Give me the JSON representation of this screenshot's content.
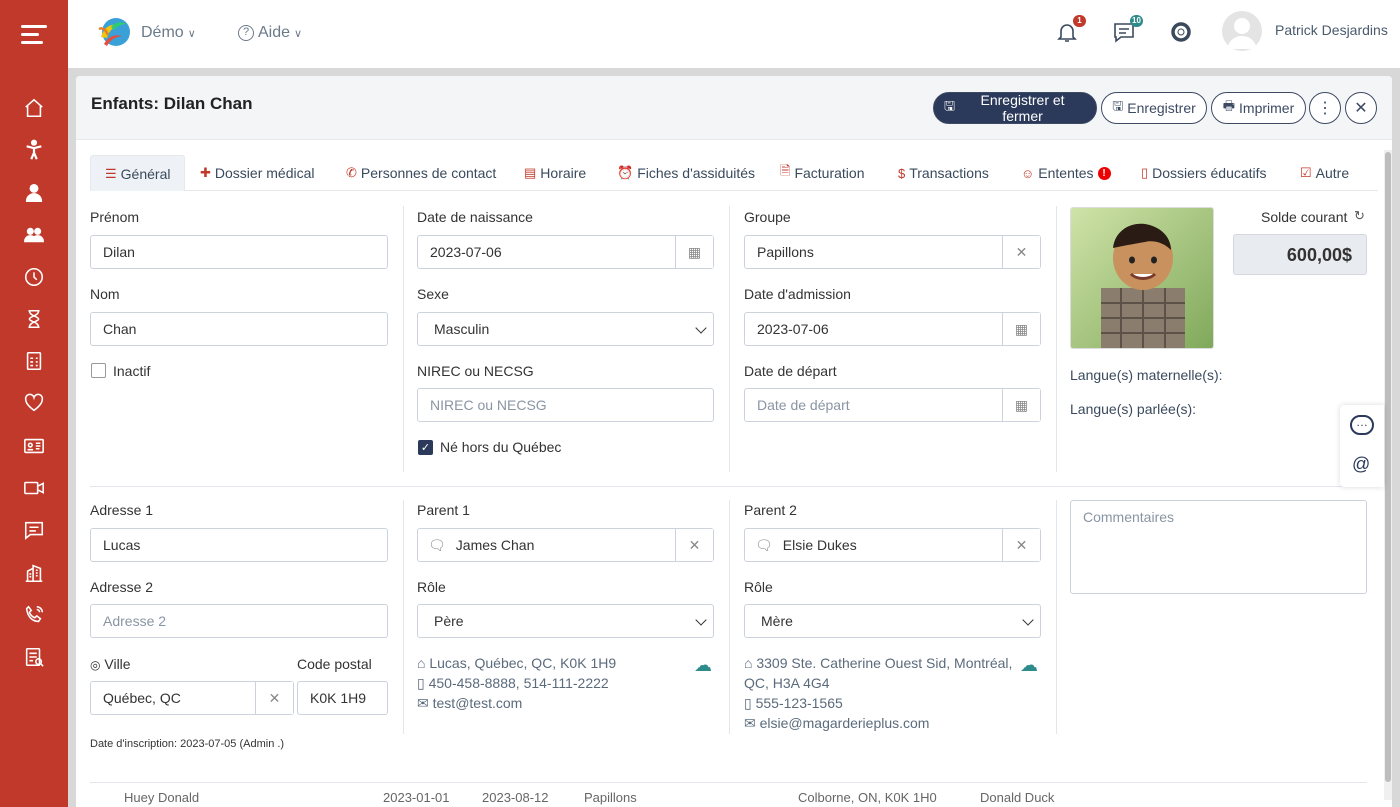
{
  "topbar": {
    "demo_label": "Démo",
    "help_label": "Aide",
    "bell_badge": "1",
    "chat_badge": "10",
    "username": "Patrick Desjardins"
  },
  "sidebar": {
    "icons": [
      "home-icon",
      "child-icon",
      "person-icon",
      "group-icon",
      "clock-icon",
      "hourglass-icon",
      "report-icon",
      "heart-icon",
      "id-card-icon",
      "video-icon",
      "message-icon",
      "building-icon",
      "phone-icon",
      "checklist-icon"
    ]
  },
  "modal": {
    "title": "Enfants: Dilan Chan",
    "buttons": {
      "save_close": "Enregistrer et fermer",
      "save": "Enregistrer",
      "print": "Imprimer"
    }
  },
  "tabs": [
    {
      "label": "Général"
    },
    {
      "label": "Dossier médical"
    },
    {
      "label": "Personnes de contact"
    },
    {
      "label": "Horaire"
    },
    {
      "label": "Fiches d'assiduités"
    },
    {
      "label": "Facturation"
    },
    {
      "label": "Transactions"
    },
    {
      "label": "Ententes"
    },
    {
      "label": "Dossiers éducatifs"
    },
    {
      "label": "Autre"
    }
  ],
  "form": {
    "prenom_label": "Prénom",
    "prenom_value": "Dilan",
    "nom_label": "Nom",
    "nom_value": "Chan",
    "inactif_label": "Inactif",
    "dob_label": "Date de naissance",
    "dob_value": "2023-07-06",
    "sexe_label": "Sexe",
    "sexe_value": "Masculin",
    "nirec_label": "NIREC ou NECSG",
    "nirec_placeholder": "NIREC ou NECSG",
    "ne_hors_label": "Né hors du Québec",
    "groupe_label": "Groupe",
    "groupe_value": "Papillons",
    "admission_label": "Date d'admission",
    "admission_value": "2023-07-06",
    "depart_label": "Date de départ",
    "depart_placeholder": "Date de départ",
    "solde_label": "Solde courant",
    "solde_value": "600,00$",
    "langue_mat_label": "Langue(s) maternelle(s):",
    "langue_parl_label": "Langue(s) parlée(s):",
    "adresse1_label": "Adresse 1",
    "adresse1_value": "Lucas",
    "adresse2_label": "Adresse 2",
    "adresse2_placeholder": "Adresse 2",
    "ville_label": "Ville",
    "ville_value": "Québec, QC",
    "postal_label": "Code postal",
    "postal_value": "K0K 1H9",
    "inscription": "Date d'inscription: 2023-07-05 (Admin .)",
    "commentaires_placeholder": "Commentaires"
  },
  "parent1": {
    "label": "Parent 1",
    "name": "James Chan",
    "role_label": "Rôle",
    "role_value": "Père",
    "address": "Lucas, Québec, QC, K0K 1H9",
    "phone": "450-458-8888, 514-111-2222",
    "email": "test@test.com"
  },
  "parent2": {
    "label": "Parent 2",
    "name": "Elsie Dukes",
    "role_label": "Rôle",
    "role_value": "Mère",
    "address_line1": "3309 Ste. Catherine Ouest Sid, Montréal,",
    "address_line2": "QC, H3A 4G4",
    "phone": "555-123-1565",
    "email": "elsie@magarderieplus.com"
  },
  "background_row": {
    "name": "Huey Donald",
    "date1": "2023-01-01",
    "date2": "2023-08-12",
    "group": "Papillons",
    "address": "Colborne, ON, K0K 1H0",
    "parent": "Donald Duck"
  },
  "colors": {
    "sidebar": "#c0392b",
    "primary": "#2b3a5a",
    "accent_red": "#c0392b"
  }
}
